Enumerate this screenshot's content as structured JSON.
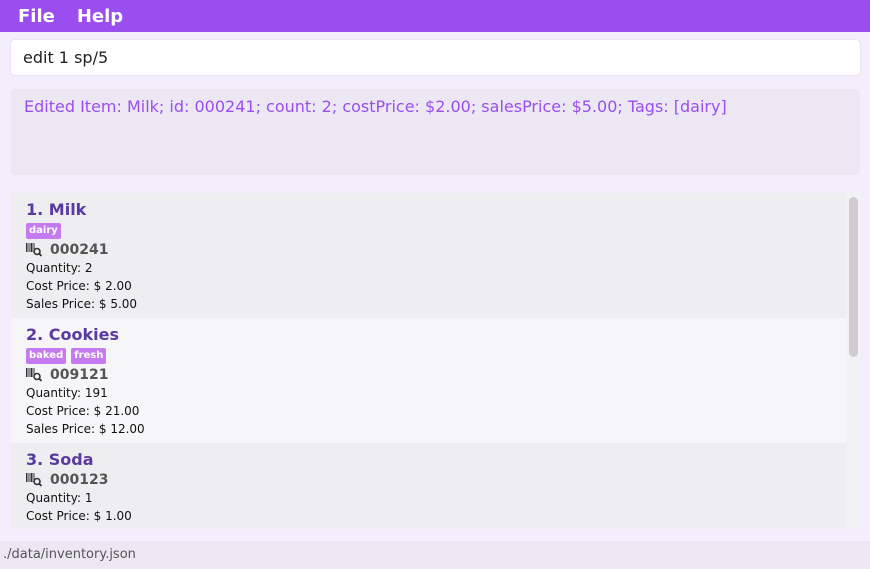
{
  "menu": {
    "file": "File",
    "help": "Help"
  },
  "command": {
    "value": "edit 1 sp/5"
  },
  "result": {
    "text": "Edited Item: Milk; id: 000241; count: 2; costPrice: $2.00; salesPrice: $5.00; Tags: [dairy]"
  },
  "items": [
    {
      "title": "1.  Milk",
      "tags": [
        "dairy"
      ],
      "id": "000241",
      "quantity": "Quantity: 2",
      "cost": "Cost Price: $ 2.00",
      "sales": "Sales Price: $ 5.00"
    },
    {
      "title": "2.  Cookies",
      "tags": [
        "baked",
        "fresh"
      ],
      "id": "009121",
      "quantity": "Quantity: 191",
      "cost": "Cost Price: $ 21.00",
      "sales": "Sales Price: $ 12.00"
    },
    {
      "title": "3.  Soda",
      "tags": [],
      "id": "000123",
      "quantity": "Quantity: 1",
      "cost": "Cost Price: $ 1.00"
    }
  ],
  "status": {
    "path": "./data/inventory.json"
  },
  "icons": {
    "barcode": "barcode-search-icon"
  },
  "colors": {
    "accent": "#9b4ef0",
    "tag": "#c47bf0",
    "title": "#5a3aa0"
  }
}
